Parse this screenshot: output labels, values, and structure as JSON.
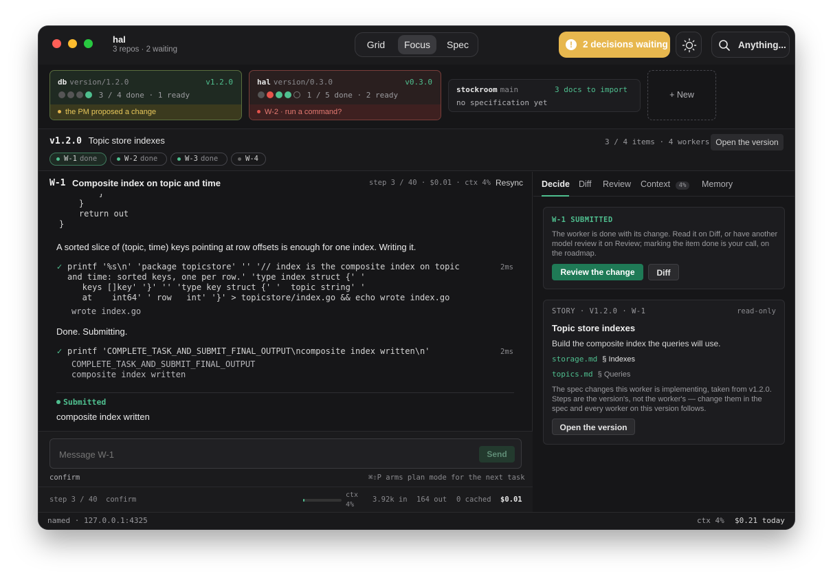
{
  "window": {
    "title": "hal",
    "subtitle": "3 repos · 2 waiting"
  },
  "view_tabs": [
    {
      "label": "Grid"
    },
    {
      "label": "Focus",
      "active": true
    },
    {
      "label": "Spec"
    }
  ],
  "decisions": {
    "label": "2 decisions waiting",
    "icon": "warning-icon"
  },
  "search": {
    "label": "Anything..."
  },
  "repos": [
    {
      "name": "db",
      "version": "version/1.2.0",
      "tag": "v1.2.0",
      "progress": "3 / 4 done · 1 ready",
      "footer": "the PM proposed a change",
      "accent": "#4fbf8f"
    },
    {
      "name": "hal",
      "version": "version/0.3.0",
      "tag": "v0.3.0",
      "progress": "1 / 5 done · 2 ready",
      "footer": "W-2 · run a command?",
      "accent": "#e5534b"
    },
    {
      "name": "stockroom",
      "branch": "main",
      "docs": "3 docs to import",
      "note": "no specification yet"
    }
  ],
  "new_repo": "+ New",
  "version_bar": {
    "version": "v1.2.0",
    "title": "Topic store indexes",
    "meta": "3 / 4 items · 4 workers",
    "open_btn": "Open the version",
    "workers": [
      {
        "id": "W-1",
        "state": "done"
      },
      {
        "id": "W-2",
        "state": "done"
      },
      {
        "id": "W-3",
        "state": "done"
      },
      {
        "id": "W-4",
        "state": ""
      }
    ]
  },
  "worker": {
    "id": "W-1",
    "title": "Composite index on topic and time",
    "meta": "step 3 / 40 · $0.01 · ctx 4%",
    "resync": "Resync"
  },
  "transcript": {
    "code_top": "        }\n    }\n    return out\n}",
    "msg1": "A sorted slice of (topic, time) keys pointing at row offsets is enough for one index. Writing it.",
    "cmd1": "printf '%s\\n' 'package topicstore' '' '// index is the composite index on topic\nand time: sorted keys, one per row.' 'type index struct {' '\n   keys []key' '}' '' 'type key struct {' '  topic string' '\n   at    int64' ' row   int' '}' > topicstore/index.go && echo wrote index.go",
    "cmd1_time": "2ms",
    "out1": "wrote index.go",
    "msg2": "Done. Submitting.",
    "cmd2": "printf 'COMPLETE_TASK_AND_SUBMIT_FINAL_OUTPUT\\ncomposite index written\\n'",
    "cmd2_time": "2ms",
    "out2": "COMPLETE_TASK_AND_SUBMIT_FINAL_OUTPUT\ncomposite index written",
    "submitted_label": "Submitted",
    "submitted_text": "composite index written"
  },
  "composer": {
    "placeholder": "Message W-1",
    "send": "Send",
    "mode": "confirm",
    "hint": "⌘⇧P arms plan mode for the next task"
  },
  "stats": {
    "step": "step 3 / 40",
    "mode": "confirm",
    "ctx_label": "ctx",
    "ctx_value": "4%",
    "ctx_fraction": 0.04,
    "tokens_in": "3.92k in",
    "tokens_out": "164 out",
    "cached": "0 cached",
    "cost": "$0.01"
  },
  "panel_tabs": [
    {
      "label": "Decide",
      "active": true
    },
    {
      "label": "Diff"
    },
    {
      "label": "Review"
    },
    {
      "label": "Context",
      "badge": "4%"
    },
    {
      "label": "Memory"
    }
  ],
  "submitted_card": {
    "heading": "W-1 SUBMITTED",
    "body": "The worker is done with its change. Read it on Diff, or have another model review it on Review; marking the item done is your call, on the roadmap.",
    "primary": "Review the change",
    "secondary": "Diff"
  },
  "story_card": {
    "heading": "STORY · V1.2.0 · W-1",
    "readonly": "read-only",
    "title": "Topic store indexes",
    "desc": "Build the composite index the queries will use.",
    "refs": [
      {
        "file": "storage.md",
        "section": "§ Indexes"
      },
      {
        "file": "topics.md",
        "section": "§ Queries"
      }
    ],
    "note": "The spec changes this worker is implementing, taken from v1.2.0. Steps are the version's, not the worker's — change them in the spec and every worker on this version follows.",
    "button": "Open the version"
  },
  "statusbar": {
    "left": "named · 127.0.0.1:4325",
    "ctx": "ctx 4%",
    "cost": "$0.21 today"
  },
  "colors": {
    "accent": "#4fbf8f",
    "warning": "#e7b74e",
    "error": "#e5534b",
    "primary_button": "#1f7a56"
  }
}
